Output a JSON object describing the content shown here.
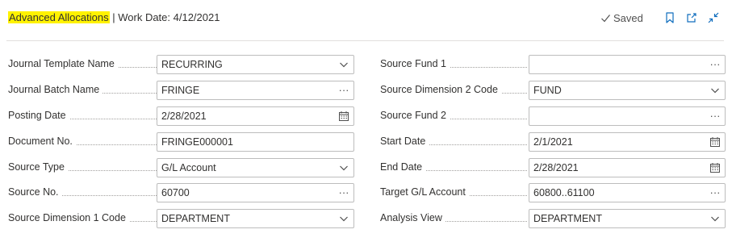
{
  "header": {
    "title": "Advanced Allocations",
    "separator": "|",
    "work_date": "Work Date: 4/12/2021",
    "status": "Saved",
    "highlight_color": "#fff200"
  },
  "icons": {
    "saved": "checkmark-icon",
    "bookmark": "bookmark-icon",
    "open_new": "open-in-new-window-icon",
    "collapse": "collapse-icon"
  },
  "left_fields": [
    {
      "label": "Journal Template Name",
      "value": "RECURRING",
      "control": "dropdown"
    },
    {
      "label": "Journal Batch Name",
      "value": "FRINGE",
      "control": "lookup"
    },
    {
      "label": "Posting Date",
      "value": "2/28/2021",
      "control": "calendar"
    },
    {
      "label": "Document No.",
      "value": "FRINGE000001",
      "control": "text"
    },
    {
      "label": "Source Type",
      "value": "G/L Account",
      "control": "select"
    },
    {
      "label": "Source No.",
      "value": "60700",
      "control": "lookup"
    },
    {
      "label": "Source Dimension 1 Code",
      "value": "DEPARTMENT",
      "control": "dropdown"
    }
  ],
  "right_fields": [
    {
      "label": "Source Fund 1",
      "value": "",
      "control": "lookup"
    },
    {
      "label": "Source Dimension 2 Code",
      "value": "FUND",
      "control": "dropdown"
    },
    {
      "label": "Source Fund 2",
      "value": "",
      "control": "lookup"
    },
    {
      "label": "Start Date",
      "value": "2/1/2021",
      "control": "calendar"
    },
    {
      "label": "End Date",
      "value": "2/28/2021",
      "control": "calendar"
    },
    {
      "label": "Target G/L Account",
      "value": "60800..61100",
      "control": "lookup"
    },
    {
      "label": "Analysis View",
      "value": "DEPARTMENT",
      "control": "dropdown"
    }
  ],
  "control_glyphs": {
    "lookup": "···"
  }
}
